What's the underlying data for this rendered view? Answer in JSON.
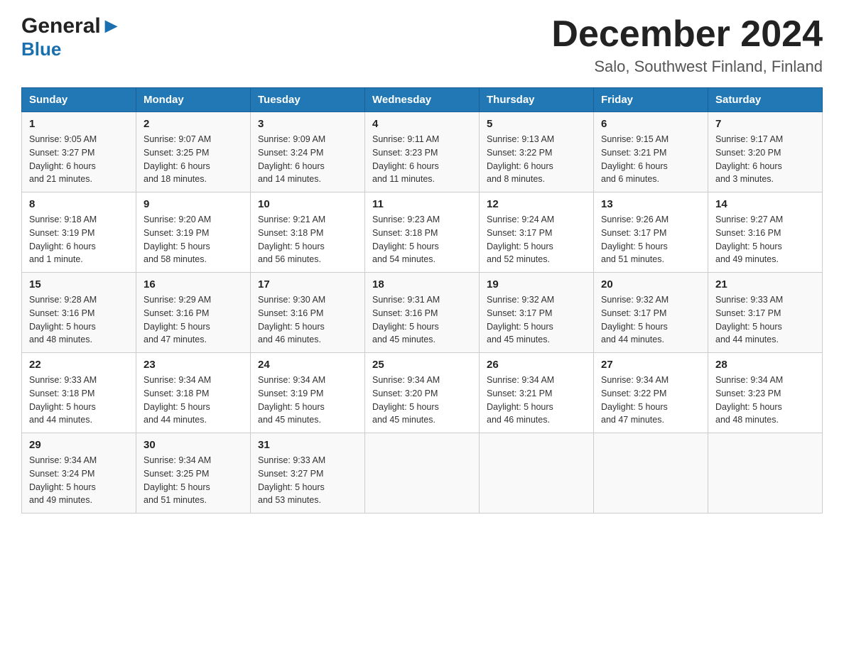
{
  "header": {
    "logo_general": "General",
    "logo_blue": "Blue",
    "logo_arrow": "▶",
    "month_title": "December 2024",
    "location": "Salo, Southwest Finland, Finland"
  },
  "days_of_week": [
    "Sunday",
    "Monday",
    "Tuesday",
    "Wednesday",
    "Thursday",
    "Friday",
    "Saturday"
  ],
  "weeks": [
    [
      {
        "day": "1",
        "sunrise": "9:05 AM",
        "sunset": "3:27 PM",
        "daylight": "6 hours and 21 minutes."
      },
      {
        "day": "2",
        "sunrise": "9:07 AM",
        "sunset": "3:25 PM",
        "daylight": "6 hours and 18 minutes."
      },
      {
        "day": "3",
        "sunrise": "9:09 AM",
        "sunset": "3:24 PM",
        "daylight": "6 hours and 14 minutes."
      },
      {
        "day": "4",
        "sunrise": "9:11 AM",
        "sunset": "3:23 PM",
        "daylight": "6 hours and 11 minutes."
      },
      {
        "day": "5",
        "sunrise": "9:13 AM",
        "sunset": "3:22 PM",
        "daylight": "6 hours and 8 minutes."
      },
      {
        "day": "6",
        "sunrise": "9:15 AM",
        "sunset": "3:21 PM",
        "daylight": "6 hours and 6 minutes."
      },
      {
        "day": "7",
        "sunrise": "9:17 AM",
        "sunset": "3:20 PM",
        "daylight": "6 hours and 3 minutes."
      }
    ],
    [
      {
        "day": "8",
        "sunrise": "9:18 AM",
        "sunset": "3:19 PM",
        "daylight": "6 hours and 1 minute."
      },
      {
        "day": "9",
        "sunrise": "9:20 AM",
        "sunset": "3:19 PM",
        "daylight": "5 hours and 58 minutes."
      },
      {
        "day": "10",
        "sunrise": "9:21 AM",
        "sunset": "3:18 PM",
        "daylight": "5 hours and 56 minutes."
      },
      {
        "day": "11",
        "sunrise": "9:23 AM",
        "sunset": "3:18 PM",
        "daylight": "5 hours and 54 minutes."
      },
      {
        "day": "12",
        "sunrise": "9:24 AM",
        "sunset": "3:17 PM",
        "daylight": "5 hours and 52 minutes."
      },
      {
        "day": "13",
        "sunrise": "9:26 AM",
        "sunset": "3:17 PM",
        "daylight": "5 hours and 51 minutes."
      },
      {
        "day": "14",
        "sunrise": "9:27 AM",
        "sunset": "3:16 PM",
        "daylight": "5 hours and 49 minutes."
      }
    ],
    [
      {
        "day": "15",
        "sunrise": "9:28 AM",
        "sunset": "3:16 PM",
        "daylight": "5 hours and 48 minutes."
      },
      {
        "day": "16",
        "sunrise": "9:29 AM",
        "sunset": "3:16 PM",
        "daylight": "5 hours and 47 minutes."
      },
      {
        "day": "17",
        "sunrise": "9:30 AM",
        "sunset": "3:16 PM",
        "daylight": "5 hours and 46 minutes."
      },
      {
        "day": "18",
        "sunrise": "9:31 AM",
        "sunset": "3:16 PM",
        "daylight": "5 hours and 45 minutes."
      },
      {
        "day": "19",
        "sunrise": "9:32 AM",
        "sunset": "3:17 PM",
        "daylight": "5 hours and 45 minutes."
      },
      {
        "day": "20",
        "sunrise": "9:32 AM",
        "sunset": "3:17 PM",
        "daylight": "5 hours and 44 minutes."
      },
      {
        "day": "21",
        "sunrise": "9:33 AM",
        "sunset": "3:17 PM",
        "daylight": "5 hours and 44 minutes."
      }
    ],
    [
      {
        "day": "22",
        "sunrise": "9:33 AM",
        "sunset": "3:18 PM",
        "daylight": "5 hours and 44 minutes."
      },
      {
        "day": "23",
        "sunrise": "9:34 AM",
        "sunset": "3:18 PM",
        "daylight": "5 hours and 44 minutes."
      },
      {
        "day": "24",
        "sunrise": "9:34 AM",
        "sunset": "3:19 PM",
        "daylight": "5 hours and 45 minutes."
      },
      {
        "day": "25",
        "sunrise": "9:34 AM",
        "sunset": "3:20 PM",
        "daylight": "5 hours and 45 minutes."
      },
      {
        "day": "26",
        "sunrise": "9:34 AM",
        "sunset": "3:21 PM",
        "daylight": "5 hours and 46 minutes."
      },
      {
        "day": "27",
        "sunrise": "9:34 AM",
        "sunset": "3:22 PM",
        "daylight": "5 hours and 47 minutes."
      },
      {
        "day": "28",
        "sunrise": "9:34 AM",
        "sunset": "3:23 PM",
        "daylight": "5 hours and 48 minutes."
      }
    ],
    [
      {
        "day": "29",
        "sunrise": "9:34 AM",
        "sunset": "3:24 PM",
        "daylight": "5 hours and 49 minutes."
      },
      {
        "day": "30",
        "sunrise": "9:34 AM",
        "sunset": "3:25 PM",
        "daylight": "5 hours and 51 minutes."
      },
      {
        "day": "31",
        "sunrise": "9:33 AM",
        "sunset": "3:27 PM",
        "daylight": "5 hours and 53 minutes."
      },
      null,
      null,
      null,
      null
    ]
  ],
  "labels": {
    "sunrise": "Sunrise:",
    "sunset": "Sunset:",
    "daylight": "Daylight:"
  }
}
